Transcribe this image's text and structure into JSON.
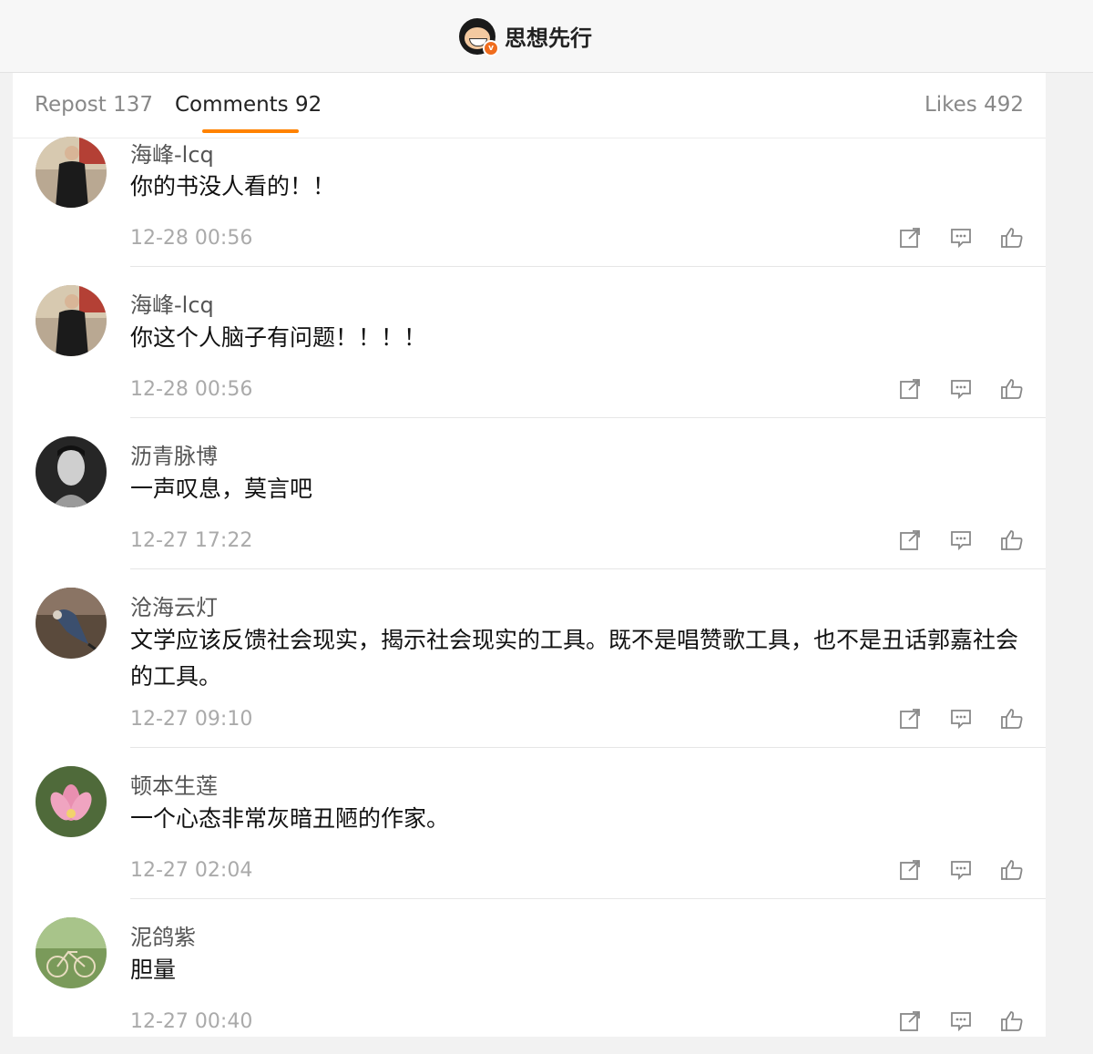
{
  "header": {
    "account_name": "思想先行",
    "avatar_icon": "cartoon-avatar-icon",
    "verified_badge": "v",
    "accent_color": "#ff8200"
  },
  "tabs": [
    {
      "label": "Repost 137",
      "active": false
    },
    {
      "label": "Comments 92",
      "active": true
    },
    {
      "label": "Likes 492",
      "active": false
    }
  ],
  "comments": [
    {
      "name": "海峰-lcq",
      "text": "你的书没人看的！！",
      "time": "12-28 00:56",
      "avatar": "man-in-black-coat-avatar"
    },
    {
      "name": "海峰-lcq",
      "text": "你这个人脑子有问题！！！！",
      "time": "12-28 00:56",
      "avatar": "man-in-black-coat-avatar"
    },
    {
      "name": "沥青脉博",
      "text": "一声叹息，莫言吧",
      "time": "12-27 17:22",
      "avatar": "bw-portrait-avatar"
    },
    {
      "name": "沧海云灯",
      "text": "文学应该反馈社会现实，揭示社会现实的工具。既不是唱赞歌工具，也不是丑话郭嘉社会的工具。",
      "time": "12-27 09:10",
      "avatar": "bird-avatar"
    },
    {
      "name": "顿本生莲",
      "text": "一个心态非常灰暗丑陋的作家。",
      "time": "12-27 02:04",
      "avatar": "lotus-flower-avatar"
    },
    {
      "name": "泥鸽紫",
      "text": "胆量",
      "time": "12-27 00:40",
      "avatar": "bicycle-in-garden-avatar"
    }
  ],
  "actions": {
    "share_icon": "share-icon",
    "comment_icon": "comment-icon",
    "like_icon": "thumbs-up-icon"
  }
}
